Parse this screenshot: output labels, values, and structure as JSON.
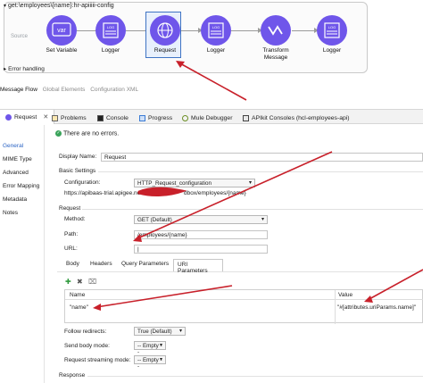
{
  "flow": {
    "title": "get:\\employees\\{name}:hr-apiiiii-config",
    "source_label": "Source",
    "error_handling": "Error handling",
    "nodes": [
      {
        "label": "Set Variable",
        "glyph": "var"
      },
      {
        "label": "Logger",
        "glyph": "LOG"
      },
      {
        "label": "Request",
        "glyph": "⊕"
      },
      {
        "label": "Logger",
        "glyph": "LOG"
      },
      {
        "label": "Transform Message",
        "glyph": "⟋⟋"
      },
      {
        "label": "Logger",
        "glyph": "LOG"
      }
    ]
  },
  "message_flow_tabs": [
    "Message Flow",
    "Global Elements",
    "Configuration XML"
  ],
  "bottom_tabs": {
    "request": "Request",
    "problems": "Problems",
    "console": "Console",
    "progress": "Progress",
    "mule_debugger": "Mule Debugger",
    "apikit": "APIkit Consoles (hcl-employees-api)"
  },
  "nav": [
    "General",
    "MIME Type",
    "Advanced",
    "Error Mapping",
    "Metadata",
    "Notes"
  ],
  "status": "There are no errors.",
  "display_name": {
    "label": "Display Name:",
    "value": "Request"
  },
  "basic_settings": {
    "heading": "Basic Settings",
    "config_label": "Configuration:",
    "config_value": "HTTP_Request_configuration",
    "url_prefix": "https://apibaas-trial.apigee.net",
    "url_suffix": "dbox/employees/{name}"
  },
  "request": {
    "heading": "Request",
    "method_label": "Method:",
    "method_value": "GET (Default)",
    "path_label": "Path:",
    "path_value": "/employees/{name}",
    "url_label": "URL:",
    "url_value": "|"
  },
  "sub_tabs": [
    "Body",
    "Headers",
    "Query Parameters",
    "URI Parameters"
  ],
  "uri_table": {
    "col_name": "Name",
    "col_value": "Value",
    "rows": [
      {
        "name": "\"name\"",
        "value": "\"#[attributes.uriParams.name]\""
      }
    ]
  },
  "follow_redirects": {
    "label": "Follow redirects:",
    "value": "True (Default)"
  },
  "send_body_mode": {
    "label": "Send body mode:",
    "value": "-- Empty --"
  },
  "streaming_mode": {
    "label": "Request streaming mode:",
    "value": "-- Empty --"
  },
  "response": {
    "heading": "Response"
  },
  "colors": {
    "node": "#6f56ea",
    "annotation": "#c8202a",
    "nav_active": "#2a63c4"
  }
}
